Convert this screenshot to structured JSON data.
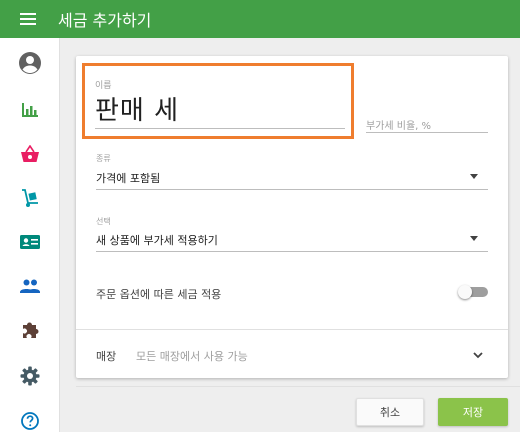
{
  "header": {
    "title": "세금 추가하기",
    "menu_icon": "hamburger-menu-icon",
    "color": "#43a047"
  },
  "sidebar": {
    "items": [
      {
        "icon": "account-circle-icon",
        "color": "#616161"
      },
      {
        "icon": "bar-chart-icon",
        "color": "#43a047"
      },
      {
        "icon": "shopping-basket-icon",
        "color": "#e91e63"
      },
      {
        "icon": "hand-truck-icon",
        "color": "#0097a7"
      },
      {
        "icon": "id-card-icon",
        "color": "#00897b"
      },
      {
        "icon": "people-icon",
        "color": "#1565c0"
      },
      {
        "icon": "puzzle-icon",
        "color": "#5d4037"
      },
      {
        "icon": "gear-icon",
        "color": "#455a64"
      },
      {
        "icon": "help-circle-icon",
        "color": "#0277bd"
      }
    ]
  },
  "form": {
    "name": {
      "label": "이름",
      "value": "판매 세"
    },
    "rate": {
      "placeholder": "부가세 비율, %"
    },
    "type": {
      "label": "종류",
      "value": "가격에 포함됨"
    },
    "option": {
      "label": "선택",
      "value": "새 상품에 부가세 적용하기"
    },
    "modifier_toggle": {
      "label": "주문 옵션에 따른 세금 적용",
      "enabled": false
    },
    "stores": {
      "label": "매장",
      "value": "모든 매장에서 사용 가능"
    }
  },
  "buttons": {
    "cancel_label": "취소",
    "save_label": "저장"
  },
  "colors": {
    "accent": "#43a047",
    "highlight": "#ef7d2e",
    "save_button": "#8bc34a"
  }
}
